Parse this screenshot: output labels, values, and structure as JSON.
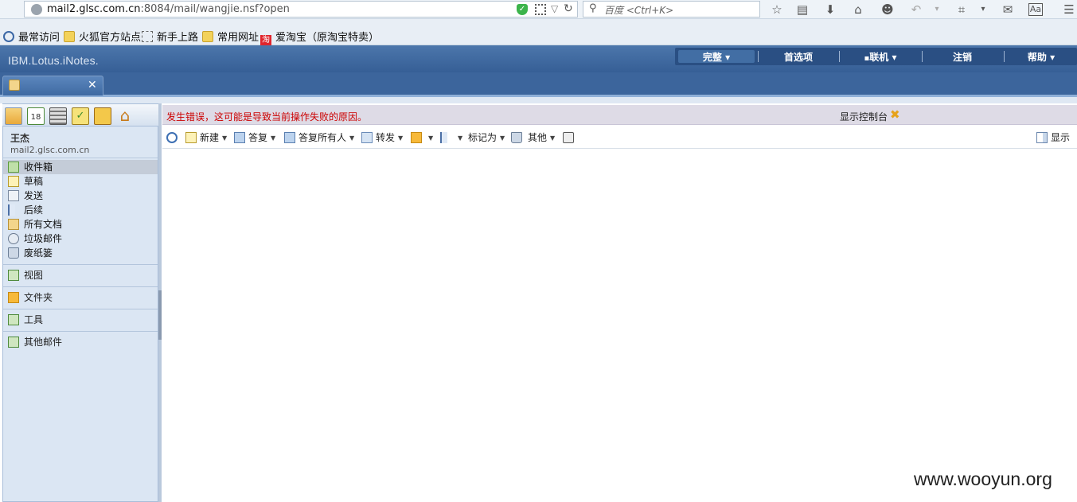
{
  "browser": {
    "url_host": "mail2.glsc.com.cn",
    "url_rest": ":8084/mail/wangjie.nsf?open",
    "search_placeholder": "百度 <Ctrl+K>"
  },
  "bookmarks": [
    {
      "label": "最常访问"
    },
    {
      "label": "火狐官方站点"
    },
    {
      "label": "新手上路"
    },
    {
      "label": "常用网址"
    },
    {
      "label": "爱淘宝（原淘宝特卖）"
    }
  ],
  "app": {
    "logo": "IBM.Lotus.iNotes.",
    "top_menu": [
      {
        "label": "完整 ▾"
      },
      {
        "label": "首选项"
      },
      {
        "label": "联机 ▾"
      },
      {
        "label": "注销"
      },
      {
        "label": "帮助 ▾"
      }
    ]
  },
  "sidebar": {
    "user_name": "王杰",
    "user_address": "mail2.glsc.com.cn",
    "folders": [
      {
        "label": "收件箱",
        "icon": "inbox-icon"
      },
      {
        "label": "草稿",
        "icon": "drafts-icon"
      },
      {
        "label": "发送",
        "icon": "sent-icon"
      },
      {
        "label": "后续",
        "icon": "followup-flag-icon"
      },
      {
        "label": "所有文档",
        "icon": "all-documents-icon"
      },
      {
        "label": "垃圾邮件",
        "icon": "junk-icon"
      },
      {
        "label": "废纸篓",
        "icon": "trash-icon"
      }
    ],
    "sections": [
      {
        "label": "视图"
      },
      {
        "label": "文件夹"
      },
      {
        "label": "工具"
      },
      {
        "label": "其他邮件"
      }
    ]
  },
  "main": {
    "error_message": "发生错误，这可能是导致当前操作失败的原因。",
    "show_console": "显示控制台",
    "toolbar": {
      "new": "新建",
      "reply": "答复",
      "reply_all": "答复所有人",
      "forward": "转发",
      "mark_as": "标记为",
      "more": "其他",
      "display": "显示"
    }
  },
  "watermark": "www.wooyun.org",
  "colors": {
    "header_blue": "#3c659c",
    "error_red": "#cc0000",
    "sidebar_bg": "#dbe6f3"
  }
}
